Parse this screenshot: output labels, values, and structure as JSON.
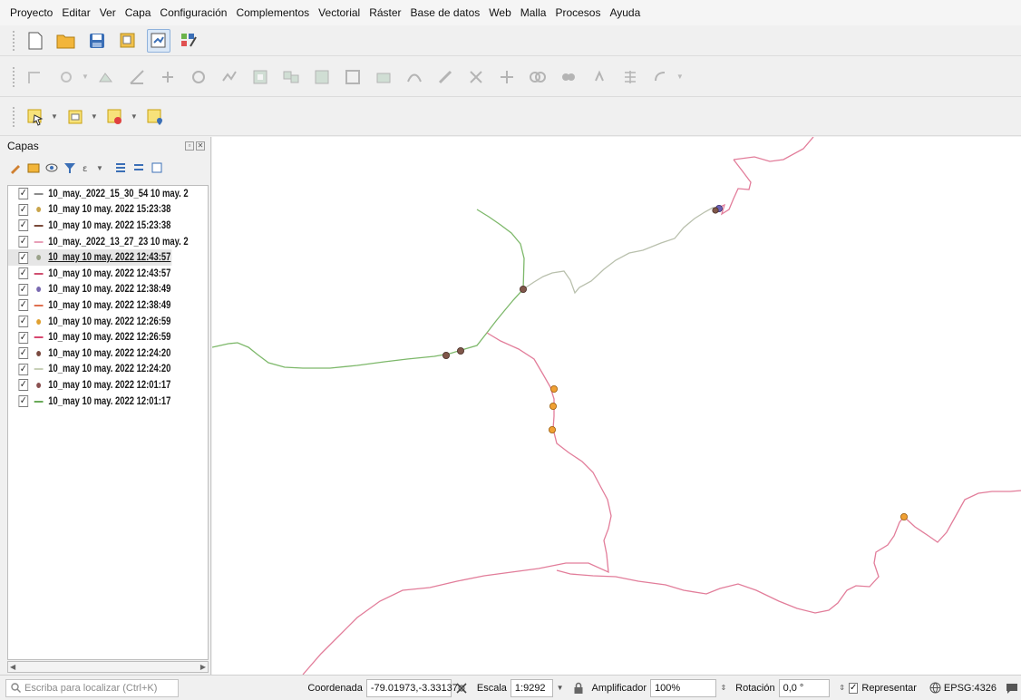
{
  "menu": [
    "Proyecto",
    "Editar",
    "Ver",
    "Capa",
    "Configuración",
    "Complementos",
    "Vectorial",
    "Ráster",
    "Base de datos",
    "Web",
    "Malla",
    "Procesos",
    "Ayuda"
  ],
  "layers_panel": {
    "title": "Capas",
    "layers": [
      {
        "label": "10_may._2022_15_30_54 10 may. 2",
        "checked": true,
        "symbol": "line",
        "color": "#8c8c8c",
        "selected": false
      },
      {
        "label": "10_may 10 may. 2022 15:23:38",
        "checked": true,
        "symbol": "point",
        "color": "#c9a44a",
        "selected": false
      },
      {
        "label": "10_may 10 may. 2022 15:23:38",
        "checked": true,
        "symbol": "line",
        "color": "#7a4a3a",
        "selected": false
      },
      {
        "label": "10_may._2022_13_27_23 10 may. 2",
        "checked": true,
        "symbol": "line",
        "color": "#e8a0b8",
        "selected": false
      },
      {
        "label": "10_may 10 may. 2022 12:43:57",
        "checked": true,
        "symbol": "point",
        "color": "#9aa28a",
        "selected": true
      },
      {
        "label": "10_may 10 may. 2022 12:43:57",
        "checked": true,
        "symbol": "line",
        "color": "#d05070",
        "selected": false
      },
      {
        "label": "10_may 10 may. 2022 12:38:49",
        "checked": true,
        "symbol": "point",
        "color": "#7868b0",
        "selected": false
      },
      {
        "label": "10_may 10 may. 2022 12:38:49",
        "checked": true,
        "symbol": "line",
        "color": "#e07050",
        "selected": false
      },
      {
        "label": "10_may 10 may. 2022 12:26:59",
        "checked": true,
        "symbol": "point",
        "color": "#e0a030",
        "selected": false
      },
      {
        "label": "10_may 10 may. 2022 12:26:59",
        "checked": true,
        "symbol": "line",
        "color": "#d84870",
        "selected": false
      },
      {
        "label": "10_may 10 may. 2022 12:24:20",
        "checked": true,
        "symbol": "point",
        "color": "#7a4a40",
        "selected": false
      },
      {
        "label": "10_may 10 may. 2022 12:24:20",
        "checked": true,
        "symbol": "line",
        "color": "#c8d0b8",
        "selected": false
      },
      {
        "label": "10_may 10 may. 2022 12:01:17",
        "checked": true,
        "symbol": "point",
        "color": "#8a5050",
        "selected": false
      },
      {
        "label": "10_may 10 may. 2022 12:01:17",
        "checked": true,
        "symbol": "line",
        "color": "#6aaa58",
        "selected": false
      }
    ]
  },
  "statusbar": {
    "locator_placeholder": "Escriba para localizar (Ctrl+K)",
    "coordinate_label": "Coordenada",
    "coordinate_value": "-79.01973,-3.33137",
    "scale_label": "Escala",
    "scale_value": "1:9292",
    "magnifier_label": "Amplificador",
    "magnifier_value": "100%",
    "rotation_label": "Rotación",
    "rotation_value": "0,0 °",
    "render_label": "Representar",
    "render_checked": true,
    "crs_label": "EPSG:4326"
  },
  "colors": {
    "track_pink": "#e27d9a",
    "track_green": "#7db86a",
    "track_gray": "#b9c0ad",
    "point_orange": "#f0a033",
    "point_brown": "#80574a",
    "point_purple": "#6b62b5"
  }
}
